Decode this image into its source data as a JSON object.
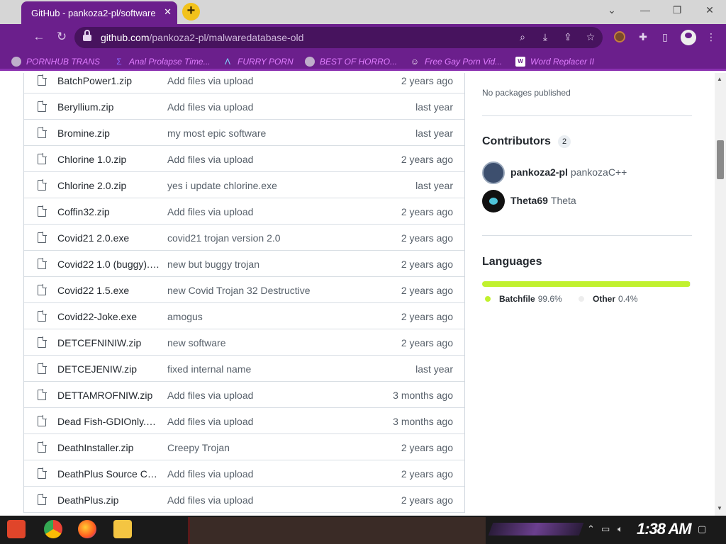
{
  "tab": {
    "title": "GitHub - pankoza2-pl/software",
    "close": "✕"
  },
  "window_controls": {
    "minimize": "—",
    "restore": "❐",
    "close": "✕",
    "dropdown": "⌄"
  },
  "address_bar": {
    "host": "github.com",
    "path": "/pankoza2-pl/malwaredatabase-old"
  },
  "bookmarks": [
    {
      "label": "PORNHUB TRANS",
      "icon": "globe-icon"
    },
    {
      "label": "Anal Prolapse Time...",
      "icon": "sigma-icon"
    },
    {
      "label": "FURRY PORN",
      "icon": "lambda-icon"
    },
    {
      "label": "BEST OF HORRO...",
      "icon": "globe-icon"
    },
    {
      "label": "Free Gay Porn Vid...",
      "icon": "robot-icon"
    },
    {
      "label": "Word Replacer II",
      "icon": "wr-icon"
    }
  ],
  "files": [
    {
      "name": "BatchPower1.zip",
      "commit": "Add files via upload",
      "age": "2 years ago"
    },
    {
      "name": "Beryllium.zip",
      "commit": "Add files via upload",
      "age": "last year"
    },
    {
      "name": "Bromine.zip",
      "commit": "my most epic software",
      "age": "last year"
    },
    {
      "name": "Chlorine 1.0.zip",
      "commit": "Add files via upload",
      "age": "2 years ago"
    },
    {
      "name": "Chlorine 2.0.zip",
      "commit": "yes i update chlorine.exe",
      "age": "last year"
    },
    {
      "name": "Coffin32.zip",
      "commit": "Add files via upload",
      "age": "2 years ago"
    },
    {
      "name": "Covid21 2.0.exe",
      "commit": "covid21 trojan version 2.0",
      "age": "2 years ago"
    },
    {
      "name": "Covid22 1.0 (buggy).e...",
      "commit": "new but buggy trojan",
      "age": "2 years ago"
    },
    {
      "name": "Covid22 1.5.exe",
      "commit": "new Covid Trojan 32 Destructive",
      "age": "2 years ago"
    },
    {
      "name": "Covid22-Joke.exe",
      "commit": "amogus",
      "age": "2 years ago"
    },
    {
      "name": "DETCEFNINIW.zip",
      "commit": "new software",
      "age": "2 years ago"
    },
    {
      "name": "DETCEJENIW.zip",
      "commit": "fixed internal name",
      "age": "last year"
    },
    {
      "name": "DETTAMROFNIW.zip",
      "commit": "Add files via upload",
      "age": "3 months ago"
    },
    {
      "name": "Dead Fish-GDIOnly.exe",
      "commit": "Add files via upload",
      "age": "3 months ago"
    },
    {
      "name": "DeathInstaller.zip",
      "commit": "Creepy Trojan",
      "age": "2 years ago"
    },
    {
      "name": "DeathPlus Source Co...",
      "commit": "Add files via upload",
      "age": "2 years ago"
    },
    {
      "name": "DeathPlus.zip",
      "commit": "Add files via upload",
      "age": "2 years ago"
    }
  ],
  "sidebar": {
    "packages_text": "No packages published",
    "contributors_title": "Contributors",
    "contributors_count": "2",
    "contributors": [
      {
        "login": "pankoza2-pl",
        "fullname": "pankozaC++"
      },
      {
        "login": "Theta69",
        "fullname": "Theta"
      }
    ],
    "languages_title": "Languages",
    "languages": [
      {
        "name": "Batchfile",
        "percent": "99.6%",
        "share": 99.6,
        "color": "#c1f12e"
      },
      {
        "name": "Other",
        "percent": "0.4%",
        "share": 0.4,
        "color": "#ededed"
      }
    ]
  },
  "taskbar": {
    "clock": "1:38 AM"
  },
  "colors": {
    "browser_theme": "#6b1f8c",
    "bookmark_text": "#e07cff"
  }
}
